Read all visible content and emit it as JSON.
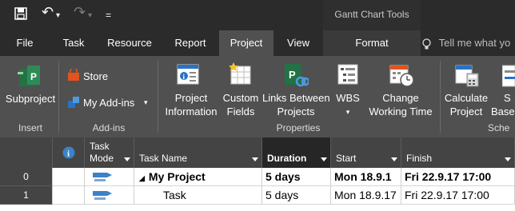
{
  "title_bar": {
    "undo_glyph": "↶",
    "redo_glyph": "↷",
    "dropdown_glyph": "▾",
    "customize_glyph": "=",
    "context_title": "Gantt Chart Tools"
  },
  "tabs": [
    {
      "label": "File",
      "active": false
    },
    {
      "label": "Task",
      "active": false
    },
    {
      "label": "Resource",
      "active": false
    },
    {
      "label": "Report",
      "active": false
    },
    {
      "label": "Project",
      "active": true
    },
    {
      "label": "View",
      "active": false
    },
    {
      "label": "Format",
      "active": false
    }
  ],
  "tell_me": "Tell me what yo",
  "ribbon": {
    "insert": {
      "subproject": "Subproject",
      "group": "Insert"
    },
    "addins": {
      "store": "Store",
      "my_addins": "My Add-ins",
      "group": "Add-ins"
    },
    "properties": {
      "project_info_1": "Project",
      "project_info_2": "Information",
      "custom_fields_1": "Custom",
      "custom_fields_2": "Fields",
      "links_1": "Links Between",
      "links_2": "Projects",
      "wbs": "WBS",
      "change_wt_1": "Change",
      "change_wt_2": "Working Time",
      "group": "Properties"
    },
    "schedule": {
      "calculate_1": "Calculate",
      "calculate_2": "Project",
      "set_base_1": "S",
      "set_base_2": "Base",
      "group": "Sche"
    }
  },
  "grid": {
    "headers": {
      "info_glyph": "i",
      "task_mode_1": "Task",
      "task_mode_2": "Mode",
      "task_name": "Task Name",
      "duration": "Duration",
      "start": "Start",
      "finish": "Finish"
    },
    "rows": [
      {
        "id": "0",
        "name": "My Project",
        "duration": "5 days",
        "start": "Mon 18.9.1",
        "finish": "Fri 22.9.17 17:00",
        "summary": true
      },
      {
        "id": "1",
        "name": "Task",
        "duration": "5 days",
        "start": "Mon 18.9.17",
        "finish": "Fri 22.9.17 17:00",
        "summary": false
      }
    ]
  },
  "colors": {
    "titlebar_bg": "#2b2b2b",
    "ribbon_bg": "#505050",
    "accent_green": "#217346",
    "store_orange": "#e2531d",
    "blue": "#2a72c4"
  }
}
